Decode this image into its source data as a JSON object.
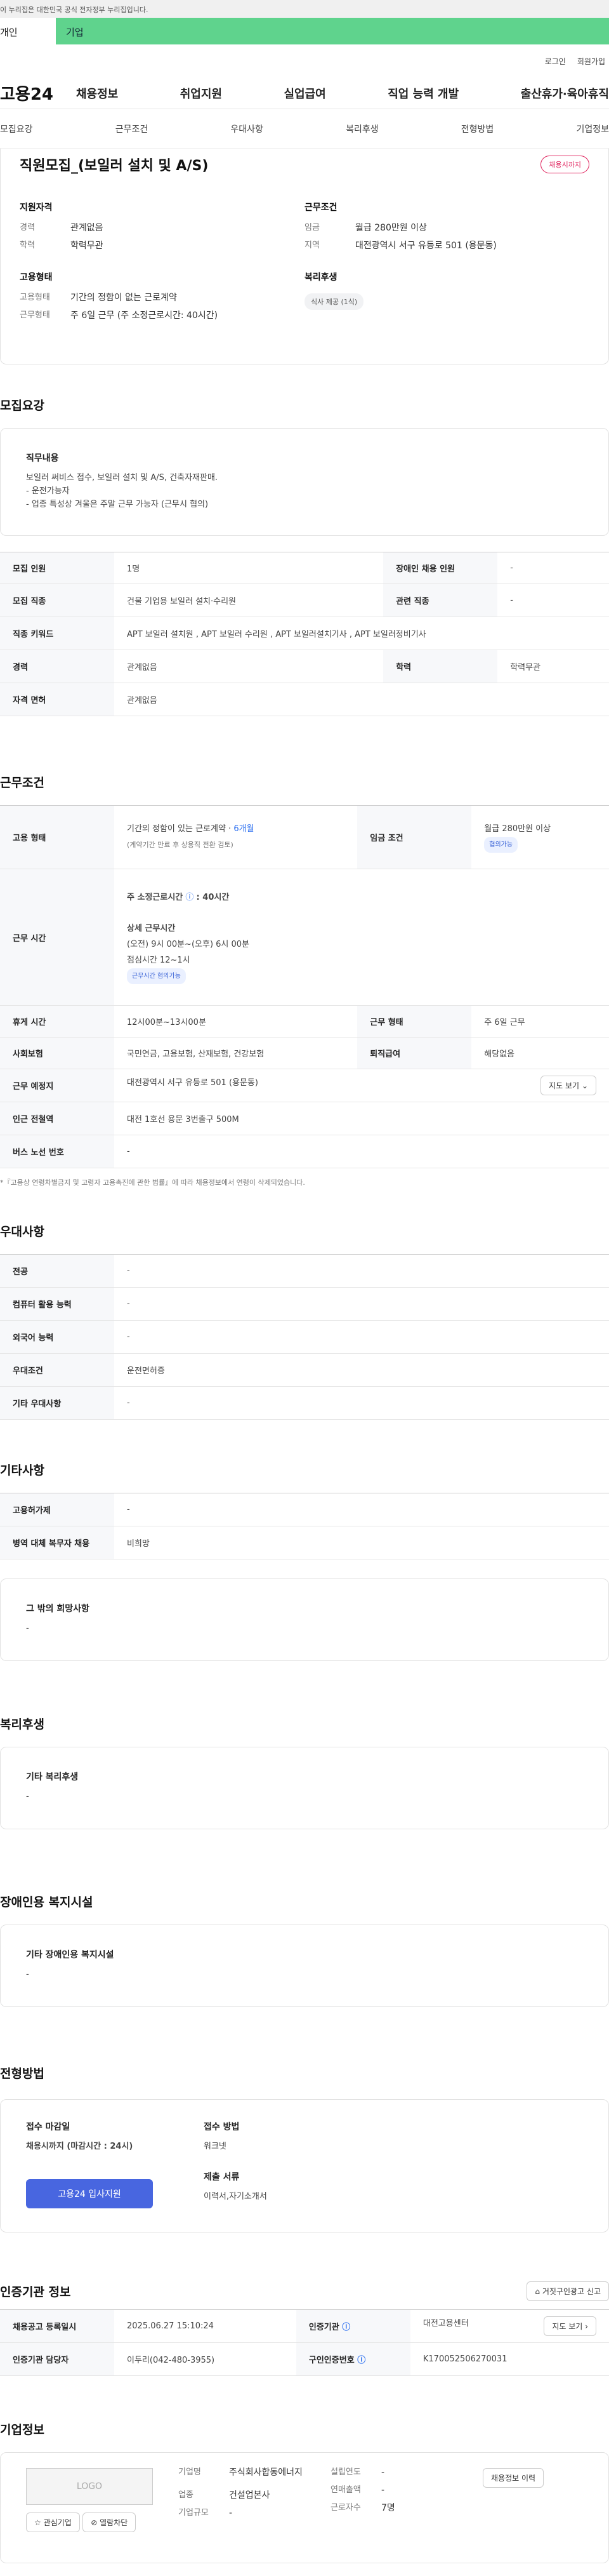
{
  "notice": "이 누리집은 대한민국 공식 전자정부 누리집입니다.",
  "top_tabs": [
    "개인",
    "기업"
  ],
  "util": [
    "로그인",
    "회원가입"
  ],
  "logo": "고용24",
  "gnb": [
    "채용정보",
    "취업지원",
    "실업급여",
    "직업 능력 개발",
    "출산휴가·육아휴직"
  ],
  "subnav": [
    "모집요강",
    "근무조건",
    "우대사항",
    "복리후생",
    "전형방법",
    "기업정보"
  ],
  "job": {
    "title": "직원모집_(보일러 설치 및 A/S)",
    "badge": "채용시까지",
    "qual_title": "지원자격",
    "career_k": "경력",
    "career_v": "관계없음",
    "edu_k": "학력",
    "edu_v": "학력무관",
    "emp_title": "고용형태",
    "emp_k": "고용형태",
    "emp_v": "기간의 정함이 없는 근로계약",
    "workform_k": "근무형태",
    "workform_v": "주 6일 근무 (주 소정근로시간: 40시간)",
    "cond_title": "근무조건",
    "wage_k": "임금",
    "wage_v": "월급 280만원 이상",
    "region_k": "지역",
    "region_v": "대전광역시 서구 유등로 501 (용문동)",
    "welfare_title": "복리후생",
    "welfare_chip": "식사 제공 (1식)"
  },
  "recruit": {
    "title": "모집요강",
    "duty_title": "직무내용",
    "duty_lines": [
      "보일러 써비스 접수, 보일러 설치 및 A/S, 건축자재판매.",
      "- 운전가능자",
      "- 업종 특성상 겨울은 주말 근무 가능자 (근무시 협의)"
    ],
    "rows": [
      {
        "h1": "모집 인원",
        "v1": "1명",
        "h2": "장애인 채용 인원",
        "v2": "-"
      },
      {
        "h1": "모집 직종",
        "v1": "건물 기업용 보일러 설치·수리원",
        "h2": "관련 직종",
        "v2": "-"
      },
      {
        "h1": "직종 키워드",
        "v1": "APT 보일러 설치원 , APT 보일러 수리원 , APT 보일러설치기사 , APT 보일러정비기사"
      },
      {
        "h1": "경력",
        "v1": "관계없음",
        "h2": "학력",
        "v2": "학력무관"
      },
      {
        "h1": "자격 면허",
        "v1": "관계없음"
      }
    ]
  },
  "work": {
    "title": "근무조건",
    "emp_h": "고용 형태",
    "emp_v1": "기간의 정함이 있는 근로계약 · ",
    "emp_v1b": "6개월",
    "emp_v2": "(계약기간 만료 후 상용직 전환 검토)",
    "wage_h": "임금 조건",
    "wage_v": "월급 280만원 이상",
    "wage_chip": "협의가능",
    "time_h": "근무 시간",
    "time_std": "주 소정근로시간",
    "time_std_v": ": 40시간",
    "time_detail_t": "상세 근무시간",
    "time_detail_v": "(오전) 9시 00분~(오후) 6시 00분",
    "time_lunch": "점심시간 12~1시",
    "time_chip": "근무시간 협의가능",
    "rest_h": "휴게 시간",
    "rest_v": "12시00분~13시00분",
    "form_h": "근무 형태",
    "form_v": "주 6일 근무",
    "ins_h": "사회보험",
    "ins_v": "국민연금, 고용보험, 산재보험, 건강보험",
    "sev_h": "퇴직급여",
    "sev_v": "해당없음",
    "place_h": "근무 예정지",
    "place_v": "대전광역시 서구 유등로 501 (용문동)",
    "map_btn": "지도 보기",
    "sub_h": "인근 전철역",
    "sub_v": "대전 1호선 용문 3번출구 500M",
    "bus_h": "버스 노선 번호",
    "bus_v": "-",
    "note": "*『고용상 연령차별금지 및 고령자 고용촉진에 관한 법률』에 따라 채용정보에서 연령이 삭제되었습니다."
  },
  "pref": {
    "title": "우대사항",
    "rows": [
      {
        "h": "전공",
        "v": "-"
      },
      {
        "h": "컴퓨터 활용 능력",
        "v": "-"
      },
      {
        "h": "외국어 능력",
        "v": "-"
      },
      {
        "h": "우대조건",
        "v": "운전면허증"
      },
      {
        "h": "기타 우대사항",
        "v": "-"
      }
    ]
  },
  "etc": {
    "title": "기타사항",
    "rows": [
      {
        "h": "고용허가제",
        "v": "-"
      },
      {
        "h": "병역 대체 복무자 채용",
        "v": "비희망"
      }
    ],
    "hope_t": "그 밖의 희망사항",
    "hope_v": "-"
  },
  "welfare": {
    "title": "복리후생",
    "box_t": "기타 복리후생",
    "box_v": "-"
  },
  "disab": {
    "title": "장애인용 복지시설",
    "box_t": "기타 장애인용 복지시설",
    "box_v": "-"
  },
  "apply": {
    "title": "전형방법",
    "deadline_t": "접수 마감일",
    "deadline_v": "채용시까지 (마감시간 : 24시)",
    "btn": "고용24 입사지원",
    "method_t": "접수 방법",
    "method_v": "워크넷",
    "docs_t": "제출 서류",
    "docs_v": "이력서,자기소개서"
  },
  "agency": {
    "title": "인증기관 정보",
    "report_btn": "거짓구인광고 신고",
    "r1h1": "채용공고 등록일시",
    "r1v1": "2025.06.27 15:10:24",
    "r1h2": "인증기관",
    "r1v2": "대전고용센터",
    "map_btn": "지도 보기",
    "r2h1": "인증기관 담당자",
    "r2v1": "이두리(042-480-3955)",
    "r2h2": "구인인증번호",
    "r2v2": "K170052506270031"
  },
  "company": {
    "title": "기업정보",
    "logo": "LOGO",
    "btn_fav": "관심기업",
    "btn_block": "열람차단",
    "name_k": "기업명",
    "name_v": "주식회사합동에너지",
    "ind_k": "업종",
    "ind_v": "건설업본사",
    "size_k": "기업규모",
    "size_v": "-",
    "year_k": "설립연도",
    "year_v": "-",
    "sales_k": "연매출액",
    "sales_v": "-",
    "emp_k": "근로자수",
    "emp_v": "7명",
    "hist_btn": "채용정보 이력"
  }
}
